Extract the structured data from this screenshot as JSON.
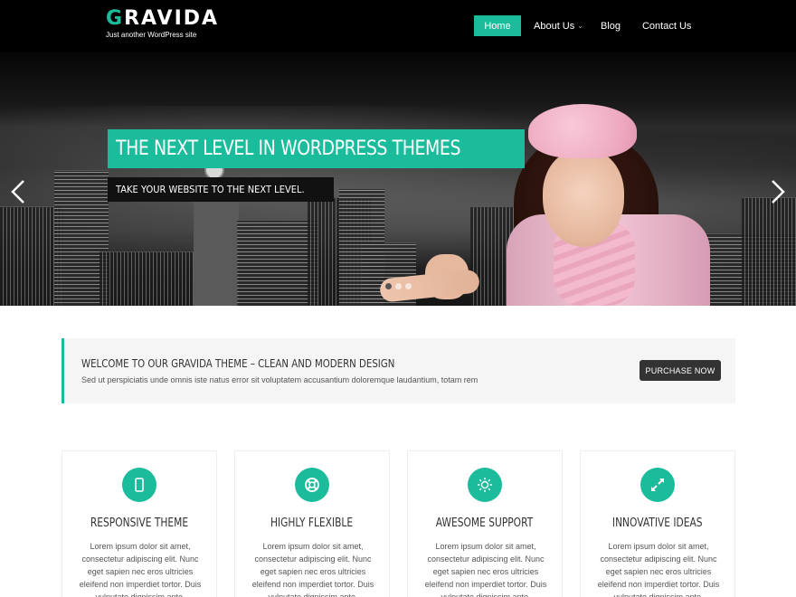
{
  "header": {
    "logo_first_letter": "G",
    "logo_rest": "RAVIDA",
    "tagline": "Just another WordPress site",
    "nav": [
      {
        "label": "Home"
      },
      {
        "label": "About Us"
      },
      {
        "label": "Blog"
      },
      {
        "label": "Contact Us"
      }
    ]
  },
  "hero": {
    "title": "THE NEXT LEVEL IN WORDPRESS THEMES",
    "subtitle": "TAKE YOUR WEBSITE TO THE NEXT LEVEL.",
    "slide_count": 3,
    "active_slide": 1
  },
  "welcome": {
    "title": "WELCOME TO OUR GRAVIDA THEME – CLEAN AND MODERN DESIGN",
    "text": "Sed ut perspiciatis unde omnis iste natus error sit voluptatem accusantium doloremque laudantium, totam rem",
    "button": "PURCHASE NOW"
  },
  "features": [
    {
      "icon": "mobile-icon",
      "title": "RESPONSIVE THEME",
      "text": "Lorem ipsum dolor sit amet, consectetur adipiscing elit. Nunc eget sapien nec eros ultricies eleifend non imperdiet tortor. Duis vulputate dignissim ante."
    },
    {
      "icon": "lifebuoy-icon",
      "title": "HIGHLY FLEXIBLE",
      "text": "Lorem ipsum dolor sit amet, consectetur adipiscing elit. Nunc eget sapien nec eros ultricies eleifend non imperdiet tortor. Duis vulputate dignissim ante."
    },
    {
      "icon": "sun-icon",
      "title": "AWESOME SUPPORT",
      "text": "Lorem ipsum dolor sit amet, consectetur adipiscing elit. Nunc eget sapien nec eros ultricies eleifend non imperdiet tortor. Duis vulputate dignissim ante."
    },
    {
      "icon": "expand-arrows-icon",
      "title": "INNOVATIVE IDEAS",
      "text": "Lorem ipsum dolor sit amet, consectetur adipiscing elit. Nunc eget sapien nec eros ultricies eleifend non imperdiet tortor. Duis vulputate dignissim ante."
    }
  ],
  "colors": {
    "accent": "#1abc9c",
    "header_bg": "#000000",
    "button_dark": "#333333"
  }
}
